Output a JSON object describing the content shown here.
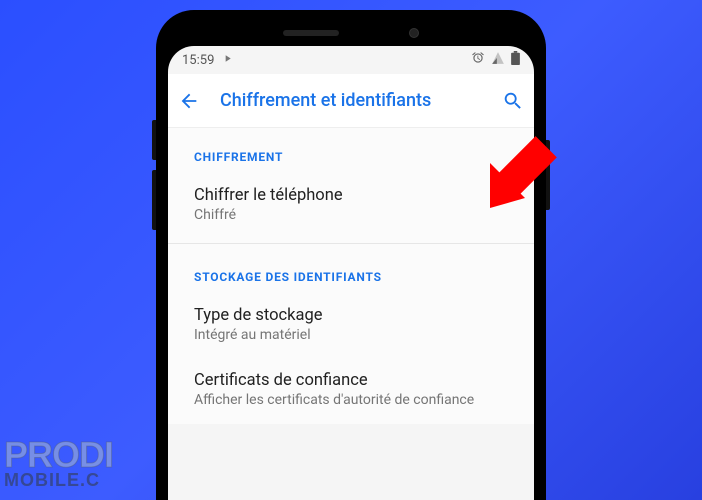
{
  "statusbar": {
    "time": "15:59"
  },
  "appbar": {
    "title": "Chiffrement et identifiants"
  },
  "sections": {
    "encryption": {
      "header": "CHIFFREMENT",
      "item1_title": "Chiffrer le téléphone",
      "item1_sub": "Chiffré"
    },
    "credentials": {
      "header": "STOCKAGE DES IDENTIFIANTS",
      "item1_title": "Type de stockage",
      "item1_sub": "Intégré au matériel",
      "item2_title": "Certificats de confiance",
      "item2_sub": "Afficher les certificats d'autorité de confiance"
    }
  },
  "watermark": {
    "line1": "PRODI",
    "line2": "MOBILE.C"
  }
}
